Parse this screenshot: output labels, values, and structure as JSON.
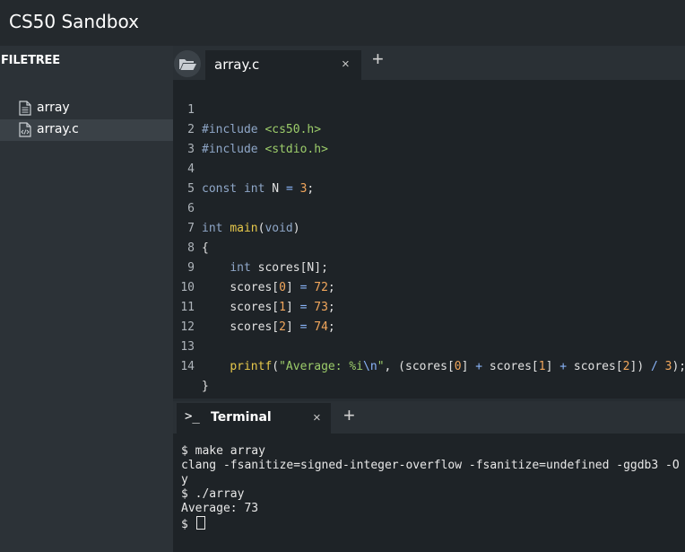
{
  "app": {
    "title": "CS50 Sandbox"
  },
  "sidebar": {
    "header": "FILETREE",
    "files": [
      {
        "name": "array",
        "icon": "text-file-icon",
        "active": false
      },
      {
        "name": "array.c",
        "icon": "code-file-icon",
        "active": true
      }
    ]
  },
  "editor": {
    "tabs": [
      {
        "label": "array.c",
        "close": "×"
      }
    ],
    "add_tab": "+",
    "folder_icon": "folder-open-icon",
    "lines": [
      {
        "n": "1"
      },
      {
        "n": "2"
      },
      {
        "n": "3"
      },
      {
        "n": "4"
      },
      {
        "n": "5"
      },
      {
        "n": "6"
      },
      {
        "n": "7"
      },
      {
        "n": "8"
      },
      {
        "n": "9"
      },
      {
        "n": "10"
      },
      {
        "n": "11"
      },
      {
        "n": "12"
      },
      {
        "n": "13"
      },
      {
        "n": "14"
      }
    ],
    "code": {
      "l1": {
        "pre": "#include",
        "inc": "<cs50.h>"
      },
      "l2": {
        "pre": "#include",
        "inc": "<stdio.h>"
      },
      "l4": {
        "kw1": "const",
        "kw2": "int",
        "name": "N",
        "eq": "=",
        "num": "3",
        "semi": ";"
      },
      "l6": {
        "kw": "int",
        "fn": "main",
        "open": "(",
        "arg": "void",
        "close": ")"
      },
      "l7": {
        "text": "{"
      },
      "l8": {
        "indent": "    ",
        "kw": "int",
        "rest": "scores[N];"
      },
      "l9": {
        "indent": "    ",
        "pre": "scores[",
        "idx": "0",
        "mid": "] ",
        "eq": "=",
        "num": "72",
        "semi": ";"
      },
      "l10": {
        "indent": "    ",
        "pre": "scores[",
        "idx": "1",
        "mid": "] ",
        "eq": "=",
        "num": "73",
        "semi": ";"
      },
      "l11": {
        "indent": "    ",
        "pre": "scores[",
        "idx": "2",
        "mid": "] ",
        "eq": "=",
        "num": "74",
        "semi": ";"
      },
      "l13": {
        "indent": "    ",
        "fn": "printf",
        "open": "(",
        "str1": "\"Average: %i",
        "esc": "\\n",
        "str2": "\"",
        "a": ", (scores[",
        "i0": "0",
        "b": "] ",
        "plus1": "+",
        "c": " scores[",
        "i1": "1",
        "d": "] ",
        "plus2": "+",
        "e": " scores[",
        "i2": "2",
        "f": "]) ",
        "div": "/",
        "g": " ",
        "three": "3",
        "h": ");"
      },
      "l14": {
        "text": "}"
      }
    }
  },
  "terminal": {
    "tab_label": "Terminal",
    "prompt_icon": ">_",
    "close": "×",
    "add": "+",
    "lines": [
      "$ make array",
      "clang -fsanitize=signed-integer-overflow -fsanitize=undefined -ggdb3 -O",
      "y",
      "$ ./array",
      "Average: 73"
    ],
    "prompt": "$ "
  }
}
